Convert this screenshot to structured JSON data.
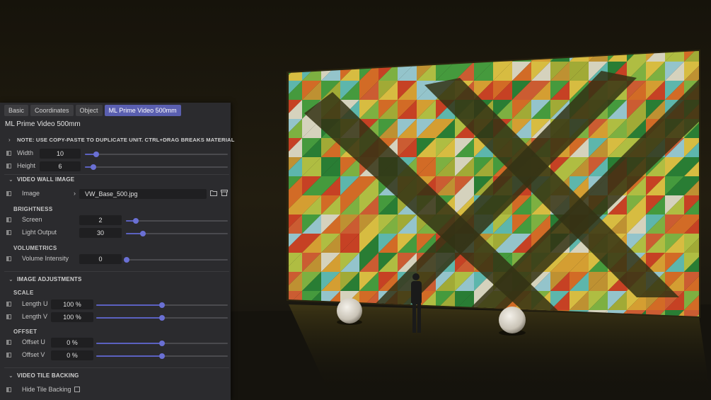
{
  "panel": {
    "tabs": [
      {
        "label": "Basic"
      },
      {
        "label": "Coordinates"
      },
      {
        "label": "Object"
      },
      {
        "label": "ML Prime Video 500mm",
        "active": true
      }
    ],
    "title": "ML Prime Video 500mm",
    "note": "NOTE: USE COPY-PASTE TO DUPLICATE UNIT. CTRL+DRAG BREAKS MATERIAL",
    "size": {
      "width": {
        "label": "Width",
        "value": "10",
        "slider": 0.08
      },
      "height": {
        "label": "Height",
        "value": "6",
        "slider": 0.05
      }
    },
    "video_wall_image": {
      "section": "VIDEO WALL IMAGE",
      "image_label": "Image",
      "image_value": "VW_Base_500.jpg",
      "brightness_label": "BRIGHTNESS",
      "screen": {
        "label": "Screen",
        "value": "2",
        "slider": 0.1
      },
      "light_output": {
        "label": "Light Output",
        "value": "30",
        "slider": 0.17
      },
      "volumetrics_label": "VOLUMETRICS",
      "volume_intensity": {
        "label": "Volume Intensity",
        "value": "0",
        "slider": 0.0
      }
    },
    "image_adjustments": {
      "section": "IMAGE ADJUSTMENTS",
      "scale_label": "SCALE",
      "length_u": {
        "label": "Length U",
        "value": "100 %",
        "slider": 0.5
      },
      "length_v": {
        "label": "Length V",
        "value": "100 %",
        "slider": 0.5
      },
      "offset_label": "OFFSET",
      "offset_u": {
        "label": "Offset U",
        "value": "0 %",
        "slider": 0.5
      },
      "offset_v": {
        "label": "Offset V",
        "value": "0 %",
        "slider": 0.5
      }
    },
    "video_tile_backing": {
      "section": "VIDEO TILE BACKING",
      "hide_tile_backing": {
        "label": "Hide Tile Backing",
        "checked": false
      }
    }
  },
  "icons": {
    "folder": "folder-icon",
    "archive": "archive-icon",
    "keyframe": "keyframe-icon",
    "chevron": "chevron-icon"
  },
  "colors": {
    "panel_bg": "#2b2b2e",
    "accent": "#5a5fb0",
    "field_bg": "#1f1f21"
  }
}
